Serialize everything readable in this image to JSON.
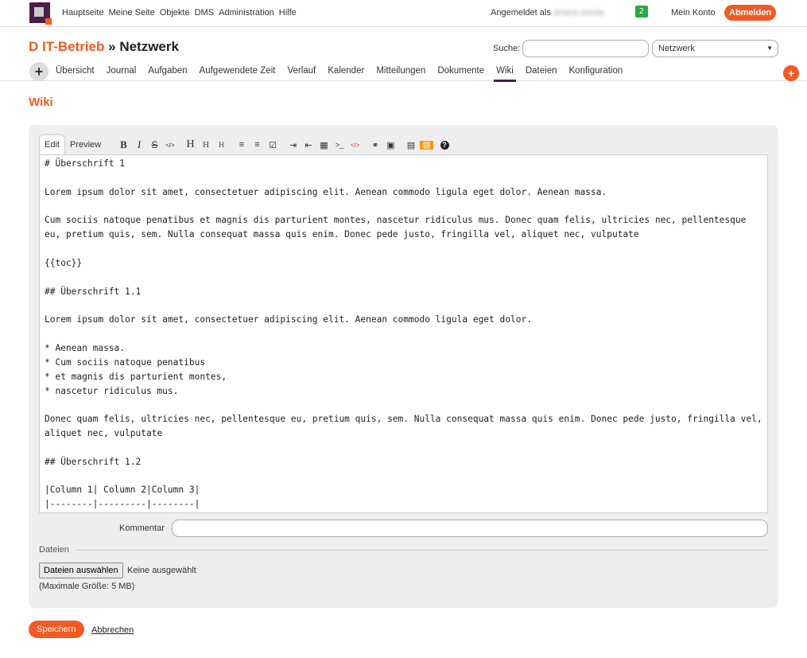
{
  "top": {
    "menu": [
      "Hauptseite",
      "Meine Seite",
      "Objekte",
      "DMS",
      "Administration",
      "Hilfe"
    ],
    "logged_as": "Angemeldet als",
    "user": "xmera omnia",
    "badge": "2",
    "account": "Mein Konto",
    "logout": "Abmelden"
  },
  "header": {
    "parent": "D IT-Betrieb",
    "sep": " » ",
    "project": "Netzwerk",
    "search_label": "Suche:",
    "search_value": "",
    "project_select": "Netzwerk"
  },
  "tabs": [
    "Übersicht",
    "Journal",
    "Aufgaben",
    "Aufgewendete Zeit",
    "Verlauf",
    "Kalender",
    "Mitteilungen",
    "Dokumente",
    "Wiki",
    "Dateien",
    "Konfiguration"
  ],
  "selected_tab": "Wiki",
  "page_title": "Wiki",
  "editor": {
    "tabs": [
      "Edit",
      "Preview"
    ],
    "toolbar": [
      "B",
      "I",
      "S",
      "</>",
      "H",
      "H",
      "H",
      "≡",
      "≡",
      "☑",
      "⇥",
      "⇤",
      "▦",
      ">_",
      "</>",
      "⚭",
      "▣",
      "▤",
      "▧",
      "?"
    ],
    "content": "# Überschrift 1\n\nLorem ipsum dolor sit amet, consectetuer adipiscing elit. Aenean commodo ligula eget dolor. Aenean massa.\n\nCum sociis natoque penatibus et magnis dis parturient montes, nascetur ridiculus mus. Donec quam felis, ultricies nec, pellentesque eu, pretium quis, sem. Nulla consequat massa quis enim. Donec pede justo, fringilla vel, aliquet nec, vulputate\n\n{{toc}}\n\n## Überschrift 1.1\n\nLorem ipsum dolor sit amet, consectetuer adipiscing elit. Aenean commodo ligula eget dolor.\n\n* Aenean massa.\n* Cum sociis natoque penatibus\n* et magnis dis parturient montes,\n* nascetur ridiculus mus.\n\nDonec quam felis, ultricies nec, pellentesque eu, pretium quis, sem. Nulla consequat massa quis enim. Donec pede justo, fringilla vel, aliquet nec, vulputate\n\n## Überschrift 1.2\n\n|Column 1| Column 2|Column 3|\n|--------|---------|--------|"
  },
  "comment_label": "Kommentar",
  "files": {
    "legend": "Dateien",
    "choose": "Dateien auswählen",
    "none": "Keine ausgewählt",
    "max": "(Maximale Größe: 5 MB)"
  },
  "actions": {
    "save": "Speichern",
    "cancel": "Abbrechen"
  },
  "colors": {
    "accent": "#f15a24",
    "brand": "#4a1e4a",
    "badge": "#28a745"
  }
}
